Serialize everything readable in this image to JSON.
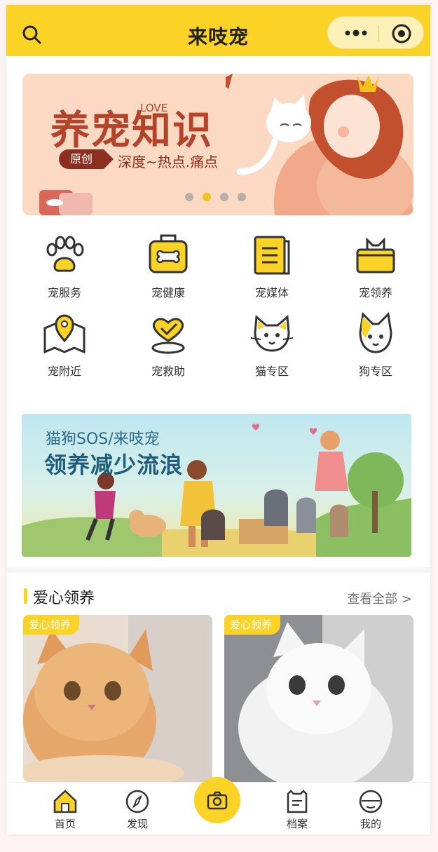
{
  "header": {
    "title": "来吱宠",
    "search_icon": "search-icon",
    "more_icon": "more-dots-icon",
    "target_icon": "close-target-icon"
  },
  "banner1": {
    "title": "养宠知识",
    "love": "LOVE",
    "tag": "原创",
    "subtitle": "深度~热点.痛点",
    "active_dot": 1,
    "dot_count": 4
  },
  "grid": [
    {
      "label": "宠服务",
      "icon": "paw-icon"
    },
    {
      "label": "宠健康",
      "icon": "health-bone-icon"
    },
    {
      "label": "宠媒体",
      "icon": "notebook-icon"
    },
    {
      "label": "宠领养",
      "icon": "pet-box-icon"
    },
    {
      "label": "宠附近",
      "icon": "map-pin-icon"
    },
    {
      "label": "宠救助",
      "icon": "rescue-heart-icon"
    },
    {
      "label": "猫专区",
      "icon": "cat-face-icon"
    },
    {
      "label": "狗专区",
      "icon": "dog-face-icon"
    }
  ],
  "banner2": {
    "line1": "猫狗SOS/来吱宠",
    "line2": "领养减少流浪"
  },
  "section": {
    "title": "爱心领养",
    "more": "查看全部 >"
  },
  "cards": [
    {
      "badge": "爱心领养"
    },
    {
      "badge": "爱心领养"
    }
  ],
  "tabbar": [
    {
      "label": "首页",
      "icon": "home-icon"
    },
    {
      "label": "发现",
      "icon": "compass-icon"
    },
    {
      "label": "",
      "icon": "camera-icon"
    },
    {
      "label": "档案",
      "icon": "archive-cat-icon"
    },
    {
      "label": "我的",
      "icon": "profile-icon"
    }
  ],
  "colors": {
    "accent": "#fbd226",
    "banner_red": "#b5432a"
  }
}
